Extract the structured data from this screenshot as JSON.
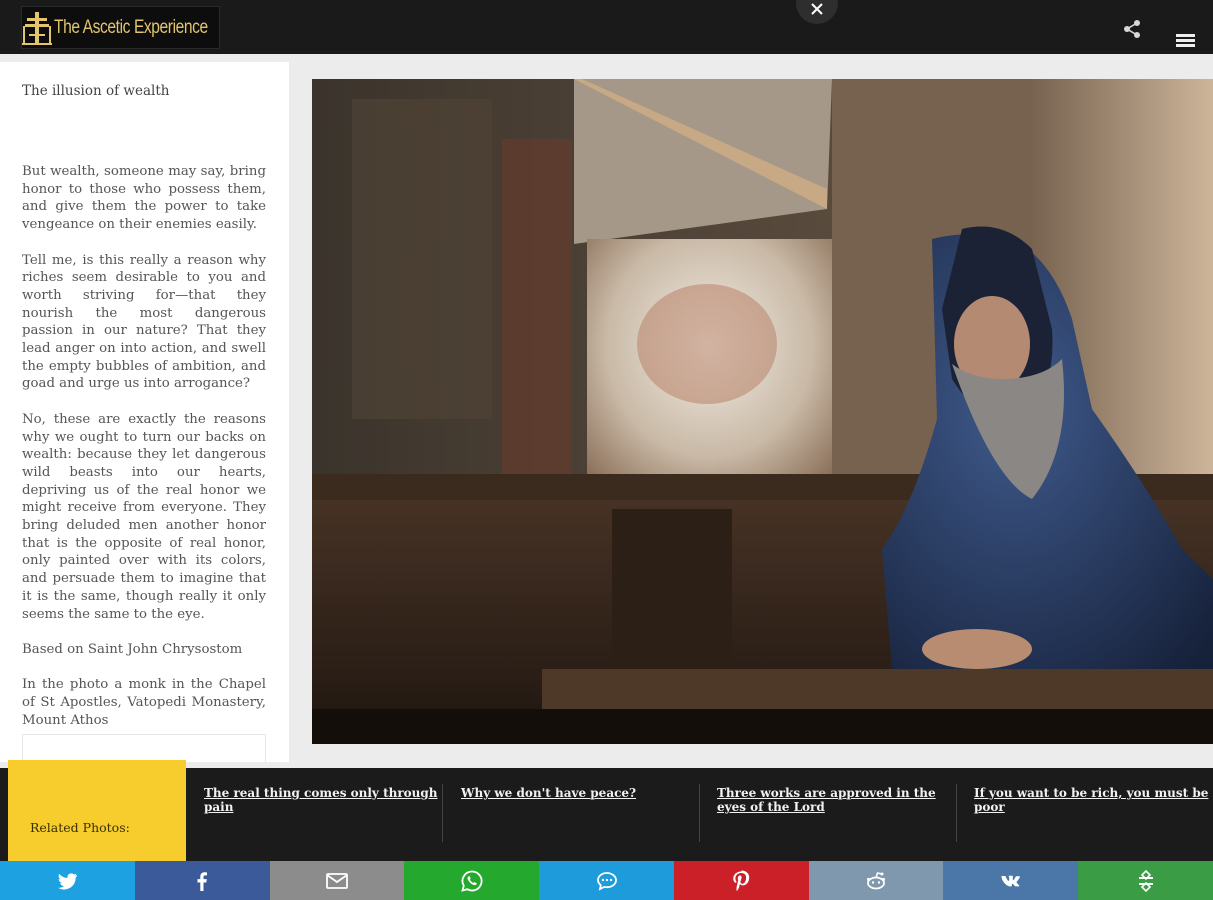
{
  "header": {
    "logo_text": "The Ascetic Experience",
    "close_label": "×"
  },
  "post": {
    "title": "The illusion of wealth",
    "paragraphs": [
      "But wealth, someone may say, bring honor to those who possess them, and give them the power to take vengeance on their enemies easily.",
      "Tell me, is this really a reason why riches seem desirable to you and worth striving for—that they nourish the most dangerous passion in our nature? That they lead anger on into action, and swell the empty bubbles of ambition, and goad and urge us into arrogance?",
      "No, these are exactly the reasons why we ought to turn our backs on wealth: because they let dangerous wild beasts into our hearts, depriving us of the real honor we might receive from everyone. They bring deluded men another honor that is the opposite of real honor, only painted over with its colors, and persuade them to imagine that it is the same, though really it only seems the same to the eye.",
      "Based on Saint John Chrysostom",
      "In the photo a monk in the Chapel of St Apostles, Vatopedi Monastery, Mount Athos"
    ]
  },
  "related": {
    "label": "Related Photos:",
    "items": [
      "The real thing comes only through pain",
      "Why we don't have peace?",
      "Three works are approved in the eyes of the Lord",
      "If you want to be rich, you must be poor"
    ]
  },
  "share_buttons": [
    {
      "icon": "twitter-icon",
      "color": "#1da1e0"
    },
    {
      "icon": "facebook-icon",
      "color": "#3b5a99"
    },
    {
      "icon": "email-icon",
      "color": "#8c8c8c"
    },
    {
      "icon": "whatsapp-icon",
      "color": "#24a92e"
    },
    {
      "icon": "sms-icon",
      "color": "#1d9bdb"
    },
    {
      "icon": "pinterest-icon",
      "color": "#cb2027"
    },
    {
      "icon": "reddit-icon",
      "color": "#7f98ad"
    },
    {
      "icon": "vk-icon",
      "color": "#4a76a8"
    },
    {
      "icon": "more-share-icon",
      "color": "#3a9d46"
    }
  ]
}
